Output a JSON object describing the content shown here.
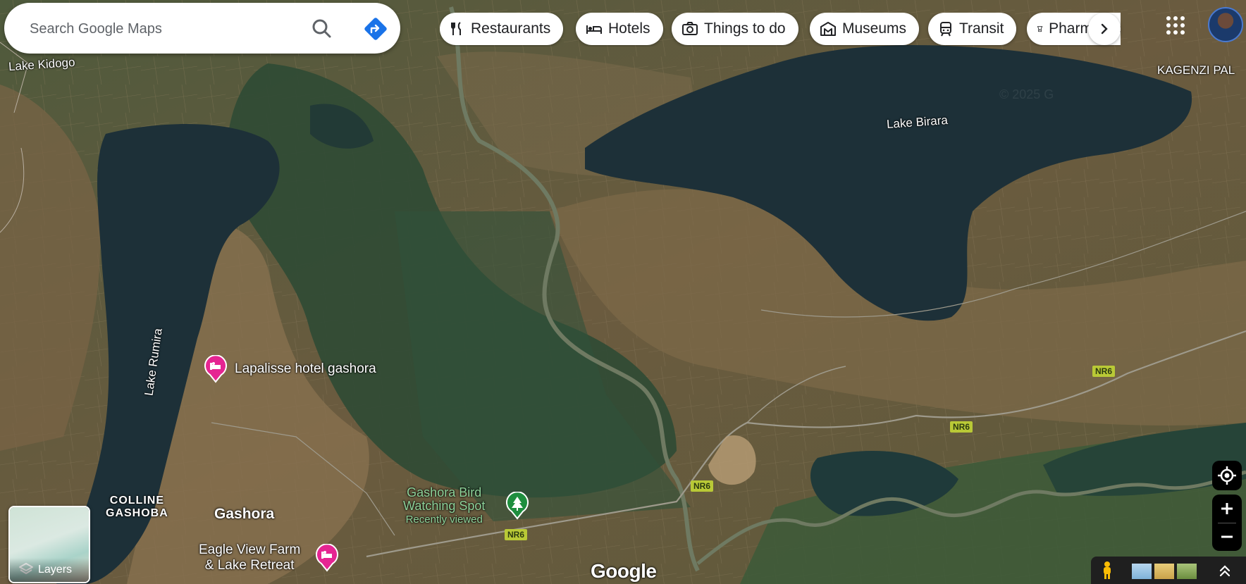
{
  "search": {
    "placeholder": "Search Google Maps"
  },
  "categories": [
    {
      "label": "Restaurants",
      "icon": "fork-knife-icon"
    },
    {
      "label": "Hotels",
      "icon": "bed-icon"
    },
    {
      "label": "Things to do",
      "icon": "camera-icon"
    },
    {
      "label": "Museums",
      "icon": "museum-icon"
    },
    {
      "label": "Transit",
      "icon": "train-icon"
    },
    {
      "label": "Pharmacies",
      "icon": "pharmacy-icon"
    }
  ],
  "map": {
    "places": {
      "lake_kidogo": "Lake Kidogo",
      "kagenzi": "KAGENZI PAL",
      "lake_birara": "Lake Birara",
      "lake_rumira": "Lake Rumira",
      "colline_line1": "COLLINE",
      "colline_line2": "GASHOBA",
      "gashora": "Gashora",
      "watermark": "© 2025 G"
    },
    "pois": {
      "hotel1": "Lapalisse hotel gashora",
      "bird_line1": "Gashora Bird",
      "bird_line2": "Watching Spot",
      "bird_sub": "Recently viewed",
      "farm_line1": "Eagle View Farm",
      "farm_line2": "& Lake Retreat"
    },
    "road_shields": [
      "NR6",
      "NR6",
      "NR6",
      "NR6"
    ]
  },
  "layers": {
    "label": "Layers"
  },
  "logo": "Google",
  "colors": {
    "hotel_pin": "#e52592",
    "park_pin": "#1e8e3e",
    "road_shield": "#b9c936",
    "water": "#1d3038",
    "chip_bg": "#ffffff"
  }
}
